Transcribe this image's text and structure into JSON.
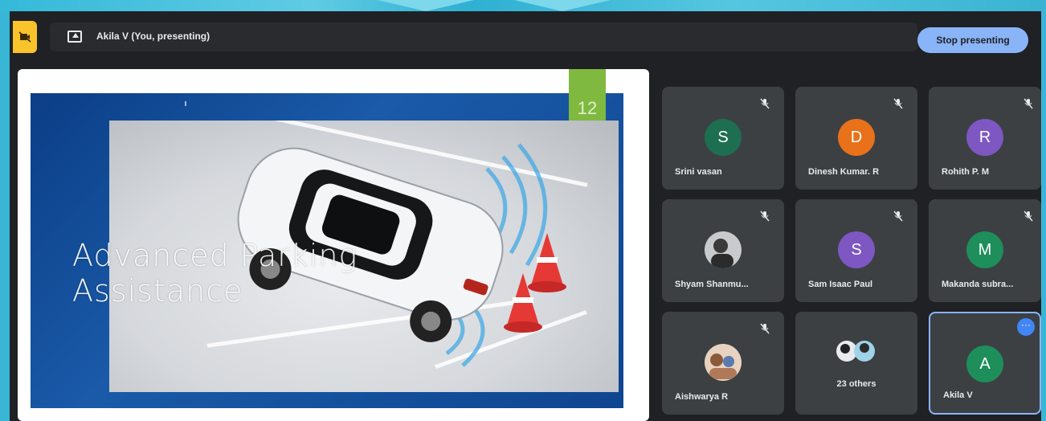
{
  "presenting_banner": {
    "label": "Akila V (You, presenting)",
    "icon": "present-screen-icon"
  },
  "stop_button": {
    "label": "Stop presenting"
  },
  "slide": {
    "title": "Advanced Parking\nAssistance",
    "slide_number": "12"
  },
  "participants": [
    {
      "name": "Srini vasan",
      "initial": "S",
      "color": "#1e6e52",
      "muted": true
    },
    {
      "name": "Dinesh Kumar. R",
      "initial": "D",
      "color": "#e8711a",
      "muted": true
    },
    {
      "name": "Rohith P. M",
      "initial": "R",
      "color": "#7e57c2",
      "muted": true
    },
    {
      "name": "Shyam Shanmu...",
      "initial": "",
      "color": "#9aa0a6",
      "muted": true,
      "photo": true
    },
    {
      "name": "Sam Isaac Paul",
      "initial": "S",
      "color": "#7e57c2",
      "muted": true
    },
    {
      "name": "Makanda subra...",
      "initial": "M",
      "color": "#1e8e5a",
      "muted": true
    },
    {
      "name": "Aishwarya R",
      "initial": "",
      "color": "#c9a27e",
      "muted": true,
      "photo": true
    },
    {
      "name": "23 others",
      "initial": "",
      "color": "",
      "muted": false,
      "group": true
    },
    {
      "name": "Akila V",
      "initial": "A",
      "color": "#1e8e5a",
      "muted": false,
      "self": true
    }
  ],
  "colors": {
    "accent": "#8ab4f8",
    "background": "#202124",
    "tile": "#3c4043"
  }
}
